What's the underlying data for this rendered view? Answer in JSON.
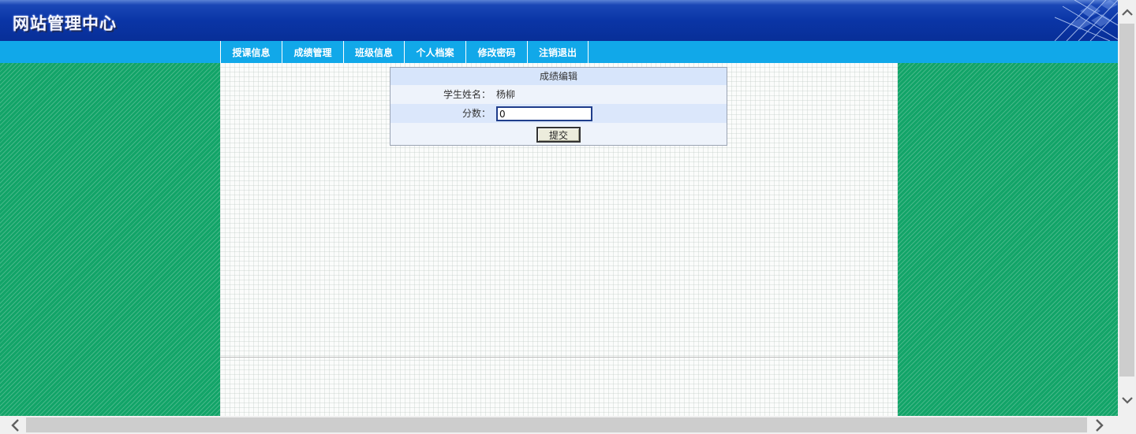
{
  "header": {
    "title": "网站管理中心"
  },
  "nav": {
    "items": [
      {
        "label": "授课信息"
      },
      {
        "label": "成绩管理"
      },
      {
        "label": "班级信息"
      },
      {
        "label": "个人档案"
      },
      {
        "label": "修改密码"
      },
      {
        "label": "注销退出"
      }
    ]
  },
  "form": {
    "caption": "成绩编辑",
    "student_label": "学生姓名：",
    "student_name": "杨柳",
    "score_label": "分数：",
    "score_value": "0",
    "submit_label": "提交"
  },
  "colors": {
    "header_blue": "#0a35a6",
    "nav_blue": "#11a8e9",
    "side_green": "#12a468",
    "form_row_blue": "#dbe7fb"
  },
  "icons": {
    "scroll_up": "chevron-up-icon",
    "scroll_down": "chevron-down-icon",
    "scroll_left": "chevron-left-icon",
    "scroll_right": "chevron-right-icon"
  }
}
